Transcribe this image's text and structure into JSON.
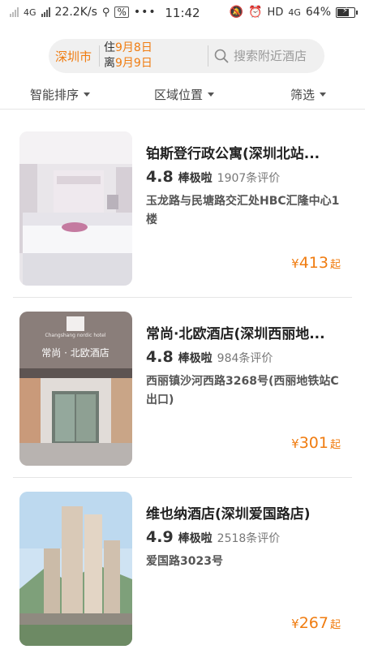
{
  "status_bar": {
    "network": "4G",
    "speed": "22.2K/s",
    "time": "11:42",
    "hd_label": "HD",
    "network2": "4G",
    "battery": "64%",
    "battery_level": 0.64
  },
  "search": {
    "city": "深圳市",
    "checkin_prefix": "住",
    "checkin_date": "9月8日",
    "checkout_prefix": "离",
    "checkout_date": "9月9日",
    "placeholder": "搜索附近酒店"
  },
  "filters": [
    {
      "label": "智能排序"
    },
    {
      "label": "区域位置"
    },
    {
      "label": "筛选"
    }
  ],
  "hotels": [
    {
      "name": "铂斯登行政公寓(深圳北站...",
      "score": "4.8",
      "score_label": "棒极啦",
      "reviews": "1907条评价",
      "address": "玉龙路与民塘路交汇处HBC汇隆中心1楼",
      "currency": "¥",
      "price": "413",
      "price_suffix": "起"
    },
    {
      "name": "常尚·北欧酒店(深圳西丽地...",
      "score": "4.8",
      "score_label": "棒极啦",
      "reviews": "984条评价",
      "address": "西丽镇沙河西路3268号(西丽地铁站C出口)",
      "currency": "¥",
      "price": "301",
      "price_suffix": "起",
      "photo_sign_en": "Changshang nordic hotel",
      "photo_sign_cn": "常尚 · 北欧酒店"
    },
    {
      "name": "维也纳酒店(深圳爱国路店)",
      "score": "4.9",
      "score_label": "棒极啦",
      "reviews": "2518条评价",
      "address": "爱国路3023号",
      "currency": "¥",
      "price": "267",
      "price_suffix": "起"
    }
  ],
  "colors": {
    "accent": "#f07c10",
    "search_bg": "#f0f0f0",
    "divider": "#e5e5e5"
  }
}
